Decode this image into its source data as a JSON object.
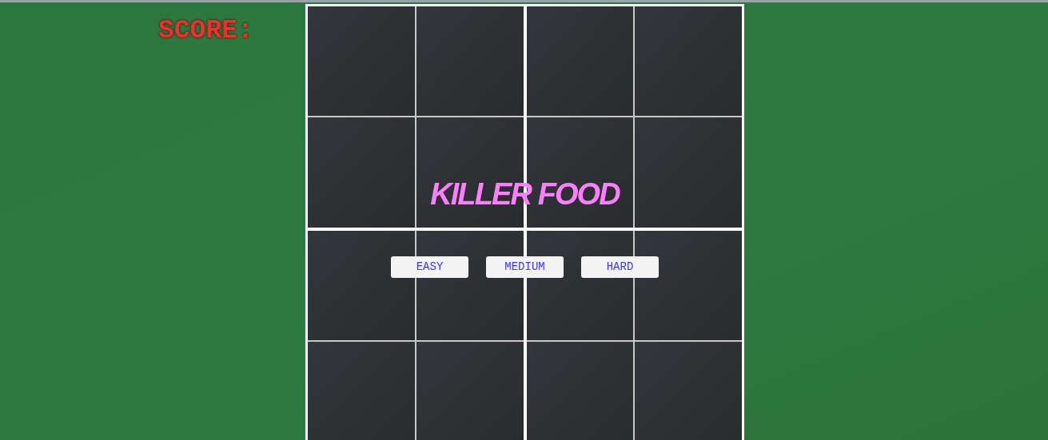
{
  "score": {
    "label": "SCORE:"
  },
  "title": "KILLER FOOD",
  "difficulty_buttons": [
    {
      "label": "EASY"
    },
    {
      "label": "MEDIUM"
    },
    {
      "label": "HARD"
    }
  ]
}
